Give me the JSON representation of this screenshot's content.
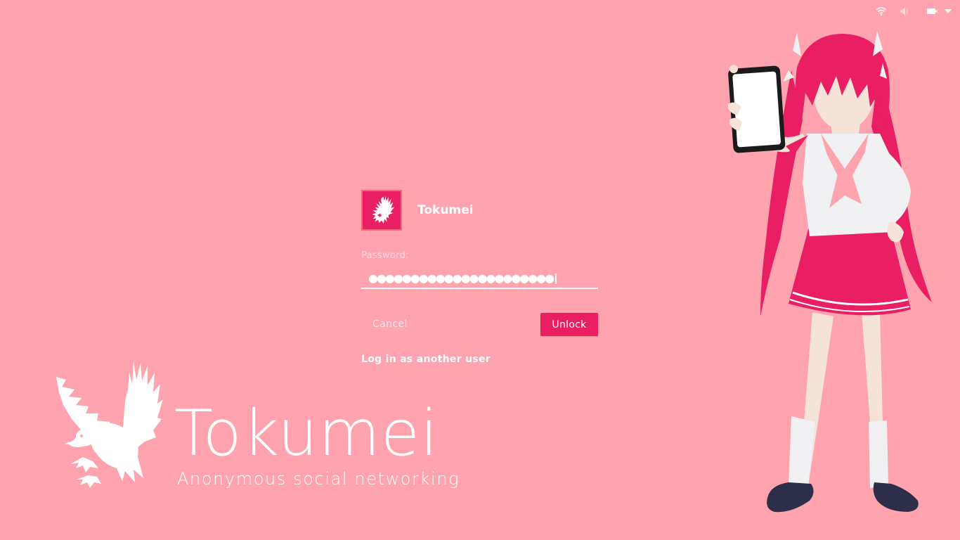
{
  "colors": {
    "background": "#ffa3ae",
    "accent": "#e91e63",
    "text": "#ffffff"
  },
  "top_bar": {
    "icons": [
      "wifi-icon",
      "volume-icon",
      "battery-icon",
      "menu-arrow-icon"
    ]
  },
  "login": {
    "username": "Tokumei",
    "avatar_icon": "eagle-icon",
    "password_label": "Password:",
    "password_masked": "●●●●●●●●●●●●●●●●●●●●●●",
    "cancel_label": "Cancel",
    "unlock_label": "Unlock",
    "another_user_label": "Log in as another user"
  },
  "brand": {
    "logo_icon": "eagle-icon",
    "name": "Tokumei",
    "tagline": "Anonymous social networking"
  }
}
